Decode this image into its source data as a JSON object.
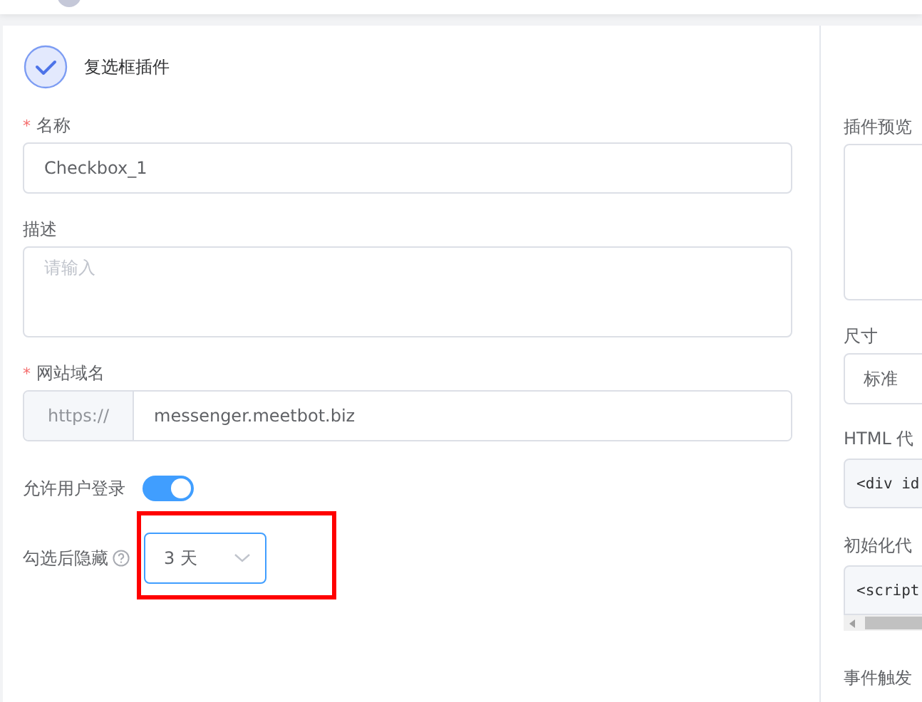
{
  "header": {
    "title": "复选框插件"
  },
  "form": {
    "name": {
      "label": "名称",
      "required_mark": "*",
      "value": "Checkbox_1"
    },
    "description": {
      "label": "描述",
      "placeholder": "请输入"
    },
    "domain": {
      "label": "网站域名",
      "required_mark": "*",
      "prefix": "https://",
      "value": "messenger.meetbot.biz"
    },
    "allow_login": {
      "label": "允许用户登录",
      "on": true
    },
    "hide_after": {
      "label": "勾选后隐藏",
      "value": "3 天"
    }
  },
  "side": {
    "preview_label": "插件预览",
    "size_label": "尺寸",
    "size_value": "标准",
    "html_label": "HTML 代",
    "html_code": "<div id",
    "init_label": "初始化代",
    "init_code": "<script",
    "event_label": "事件触发"
  }
}
